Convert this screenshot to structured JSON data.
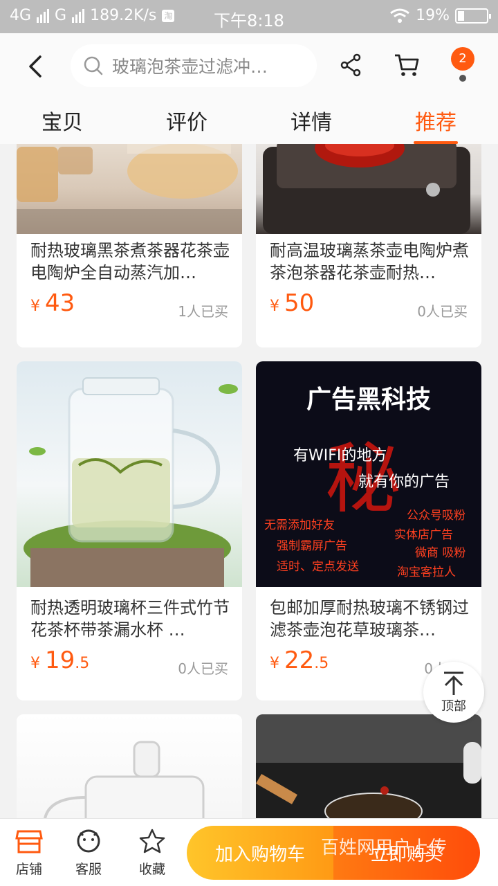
{
  "status": {
    "network": "4G",
    "network2": "G",
    "speed": "189.2K/s",
    "speed_icon": "淘",
    "time": "下午8:18",
    "battery": "19%"
  },
  "header": {
    "search_placeholder": "玻璃泡茶壶过滤冲…",
    "message_count": "2",
    "tabs": [
      "宝贝",
      "评价",
      "详情",
      "推荐"
    ],
    "active_tab": "推荐"
  },
  "products": [
    {
      "title": "耐热玻璃黑茶煮茶器花茶壶电陶炉全自动蒸汽加…",
      "currency": "¥",
      "price_int": "43",
      "price_dec": "",
      "sold": "1人已买"
    },
    {
      "title": "耐高温玻璃蒸茶壶电陶炉煮茶泡茶器花茶壶耐热…",
      "currency": "¥",
      "price_int": "50",
      "price_dec": "",
      "sold": "0人已买"
    },
    {
      "title": "耐热透明玻璃杯三件式竹节花茶杯带茶漏水杯 …",
      "currency": "¥",
      "price_int": "19",
      "price_dec": ".5",
      "sold": "0人已买"
    },
    {
      "title": "包邮加厚耐热玻璃不锈钢过滤茶壶泡花草玻璃茶…",
      "currency": "¥",
      "price_int": "22",
      "price_dec": ".5",
      "sold": "0人"
    }
  ],
  "ad": {
    "title": "广告黑科技",
    "line1": "有WIFI的地方",
    "line2": "就有你的广告",
    "big_char": "秘",
    "left1": "无需添加好友",
    "left2": "强制霸屏广告",
    "left3": "适时、定点发送",
    "right1": "公众号吸粉",
    "right2": "实体店广告",
    "right3": "微商 吸粉",
    "right4": "淘宝客拉人"
  },
  "back_to_top": "顶部",
  "bottom": {
    "shop": "店铺",
    "service": "客服",
    "favorite": "收藏",
    "add_cart": "加入购物车",
    "buy_now": "立即购买",
    "watermark": "百姓网用户上传"
  },
  "colors": {
    "accent": "#ff5a10",
    "cart_button": "#ffa51e",
    "buy_button": "#ff5a0e"
  }
}
